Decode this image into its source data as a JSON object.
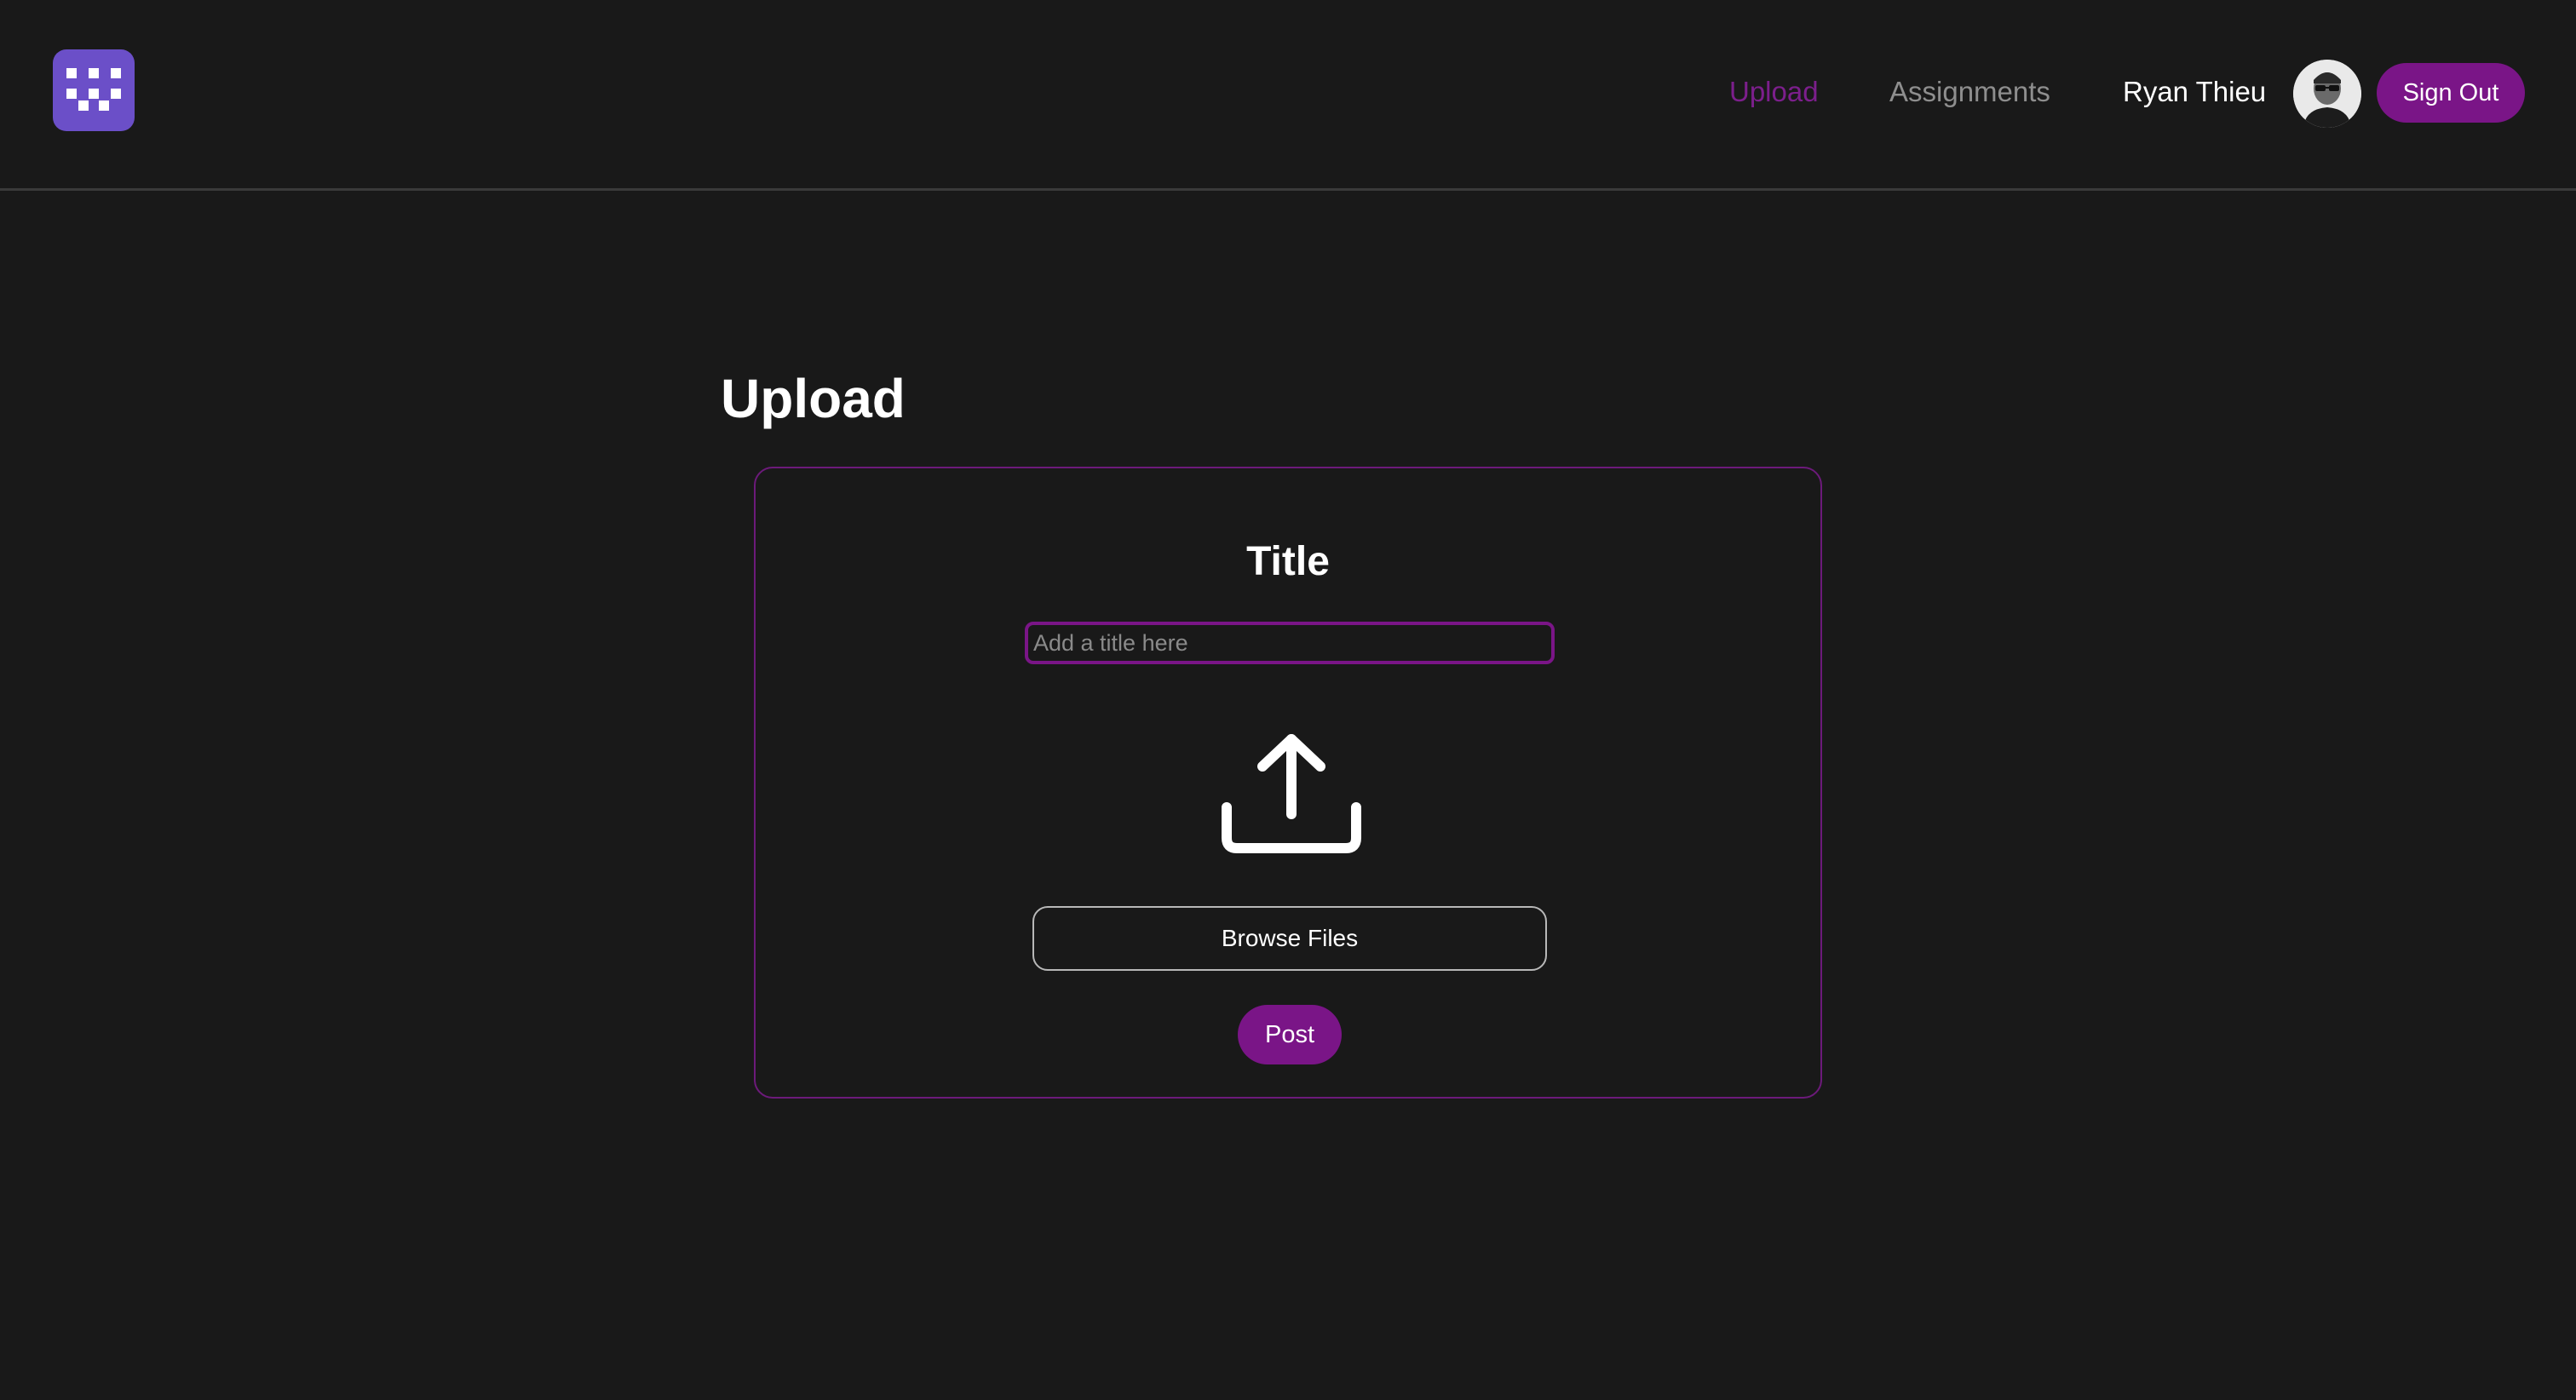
{
  "nav": {
    "links": [
      {
        "label": "Upload",
        "active": true
      },
      {
        "label": "Assignments",
        "active": false
      }
    ],
    "user_name": "Ryan Thieu",
    "sign_out_label": "Sign Out"
  },
  "page": {
    "title": "Upload"
  },
  "form": {
    "title_label": "Title",
    "title_placeholder": "Add a title here",
    "title_value": "",
    "upload_icon": "upload-icon",
    "browse_label": "Browse Files",
    "post_label": "Post"
  },
  "colors": {
    "background": "#191919",
    "accent": "#7a1587",
    "logo": "#6b4fc8",
    "muted_text": "#8e8e8e"
  }
}
